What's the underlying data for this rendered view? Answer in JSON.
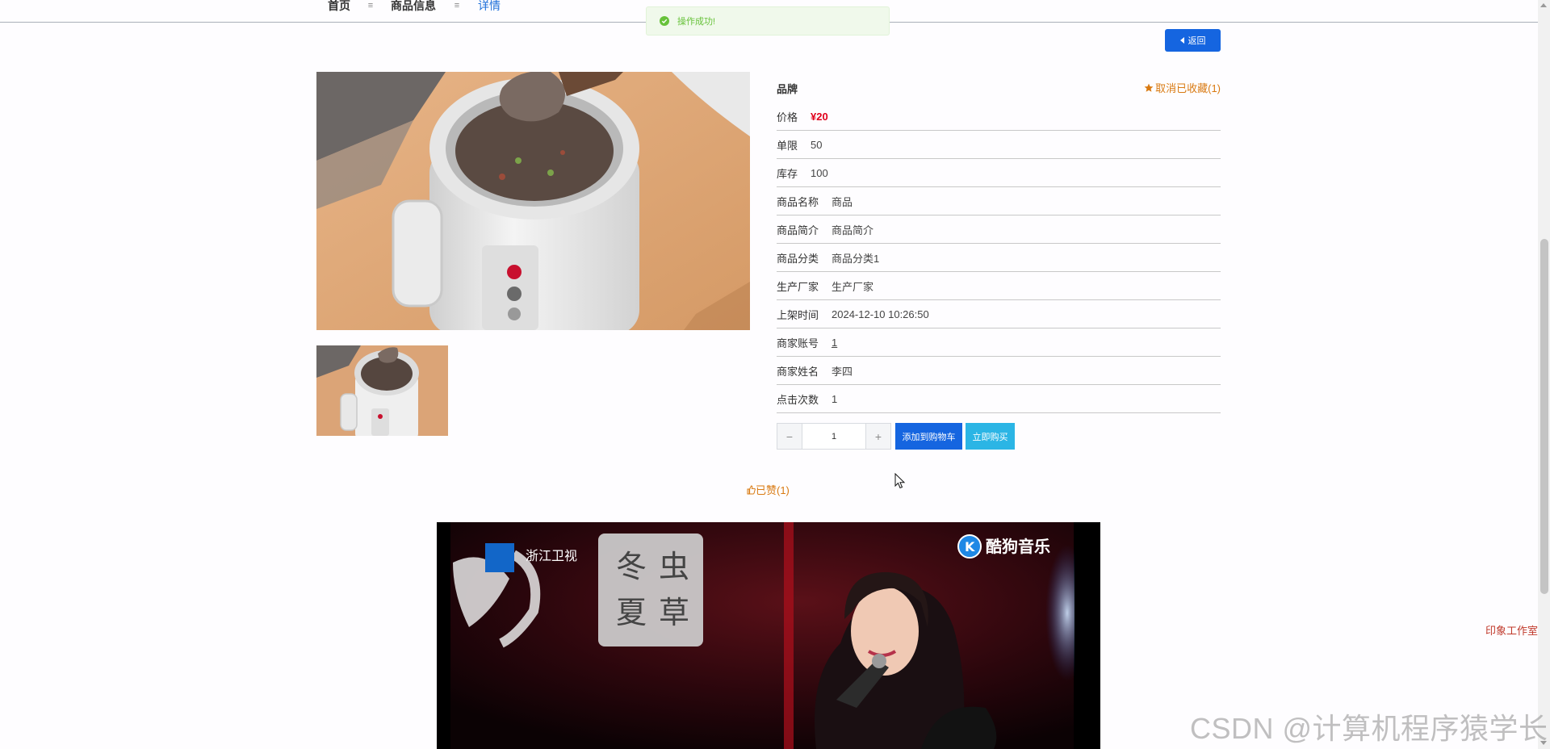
{
  "breadcrumb": {
    "home": "首页",
    "product_info": "商品信息",
    "detail": "详情",
    "separator": "≡"
  },
  "toast": {
    "message": "操作成功!",
    "type": "success"
  },
  "back_button": {
    "label": "返回"
  },
  "product": {
    "brand_label": "品牌",
    "favorite_label": "取消已收藏(1)",
    "fields": {
      "price": {
        "key": "价格",
        "value": "¥20"
      },
      "limit": {
        "key": "单限",
        "value": "50"
      },
      "stock": {
        "key": "库存",
        "value": "100"
      },
      "name": {
        "key": "商品名称",
        "value": "商品"
      },
      "intro": {
        "key": "商品简介",
        "value": "商品简介"
      },
      "category": {
        "key": "商品分类",
        "value": "商品分类1"
      },
      "manufacturer": {
        "key": "生产厂家",
        "value": "生产厂家"
      },
      "listed_time": {
        "key": "上架时间",
        "value": "2024-12-10 10:26:50"
      },
      "merchant_account": {
        "key": "商家账号",
        "value": "1"
      },
      "merchant_name": {
        "key": "商家姓名",
        "value": "李四"
      },
      "clicks": {
        "key": "点击次数",
        "value": "1"
      }
    }
  },
  "purchase": {
    "minus": "−",
    "plus": "+",
    "quantity": "1",
    "add_to_cart_label": "添加到购物车",
    "buy_now_label": "立即购买"
  },
  "like": {
    "label": "已赞(1)"
  },
  "video": {
    "channel_logo_text": "浙江卫视",
    "song_title": [
      "冬",
      "虫",
      "夏",
      "草"
    ],
    "brand_text": "酷狗音乐",
    "brand_badge": "K"
  },
  "side_link": {
    "label": "印象工作室"
  },
  "watermark": {
    "text": "CSDN @计算机程序猿学长"
  },
  "colors": {
    "primary": "#1565e0",
    "info": "#2bb5e5",
    "accent": "#d97a12",
    "price": "#e0001b",
    "success": "#67c23a"
  }
}
